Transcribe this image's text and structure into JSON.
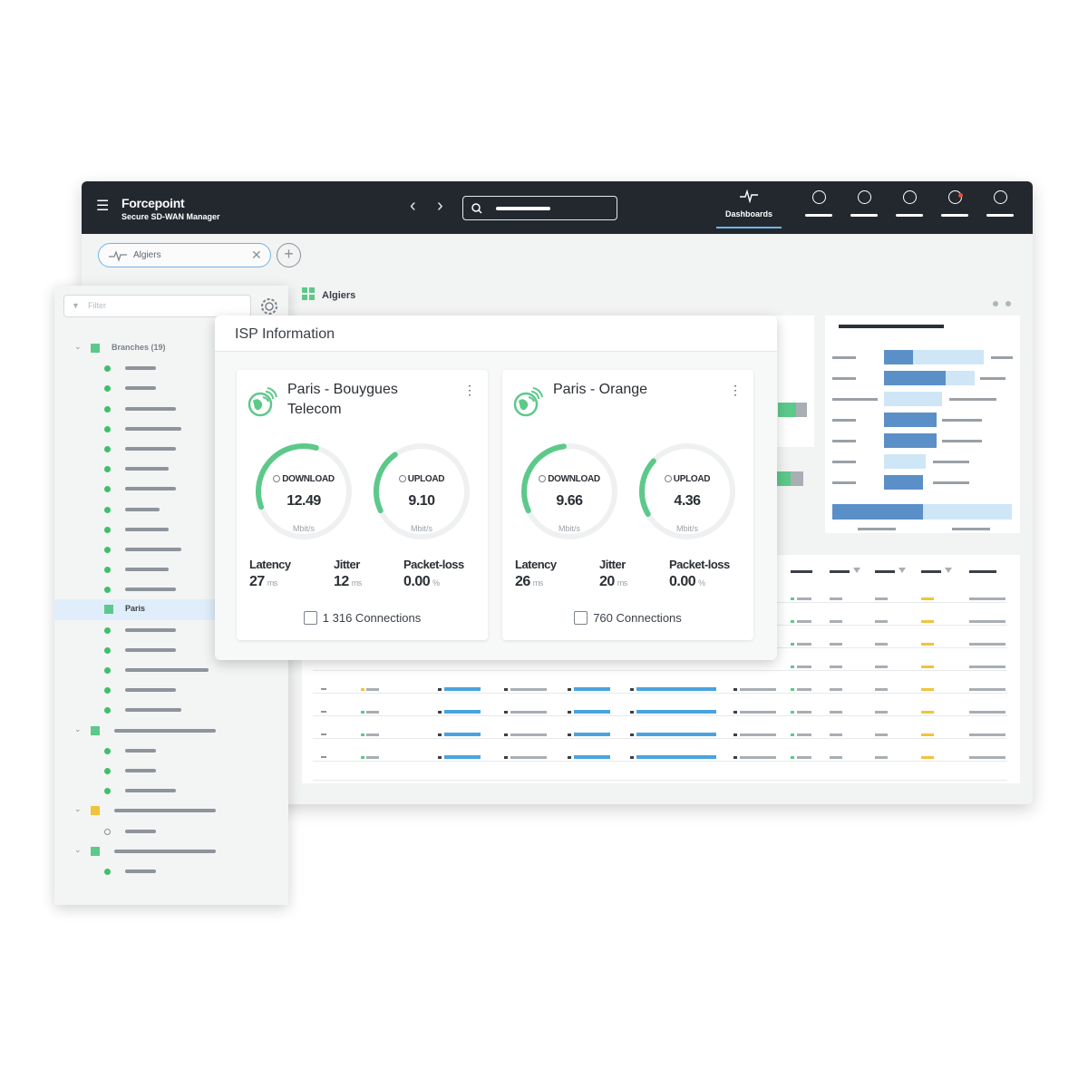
{
  "app": {
    "brand_name": "Forcepoint",
    "brand_subtitle": "Secure SD-WAN Manager",
    "dashboards_label": "Dashboards",
    "tab_label": "Algiers",
    "breadcrumb": "Algiers"
  },
  "sidebar": {
    "filter_placeholder": "Filter",
    "group_label": "Branches (19)",
    "selected_item": "Paris"
  },
  "isp_panel": {
    "title": "ISP Information",
    "cards": [
      {
        "name": "Paris - Bouygues Telecom",
        "download_label": "DOWNLOAD",
        "download_value": "12.49",
        "download_unit": "Mbit/s",
        "upload_label": "UPLOAD",
        "upload_value": "9.10",
        "upload_unit": "Mbit/s",
        "latency_label": "Latency",
        "latency_value": "27",
        "latency_unit": "ms",
        "jitter_label": "Jitter",
        "jitter_value": "12",
        "jitter_unit": "ms",
        "packetloss_label": "Packet-loss",
        "packetloss_value": "0.00",
        "packetloss_unit": "%",
        "connections": "1 316 Connections"
      },
      {
        "name": "Paris - Orange",
        "download_label": "DOWNLOAD",
        "download_value": "9.66",
        "download_unit": "Mbit/s",
        "upload_label": "UPLOAD",
        "upload_value": "4.36",
        "upload_unit": "Mbit/s",
        "latency_label": "Latency",
        "latency_value": "26",
        "latency_unit": "ms",
        "jitter_label": "Jitter",
        "jitter_value": "20",
        "jitter_unit": "ms",
        "packetloss_label": "Packet-loss",
        "packetloss_value": "0.00",
        "packetloss_unit": "%",
        "connections": "760 Connections"
      }
    ]
  },
  "colors": {
    "topbar": "#23282f",
    "accent_blue": "#6fb5e8",
    "gauge_green": "#5cc98a",
    "status_green": "#3fbf6a",
    "status_yellow": "#f0c43a",
    "bar_dark": "#5b8fc7",
    "bar_light": "#cfe6f7"
  }
}
